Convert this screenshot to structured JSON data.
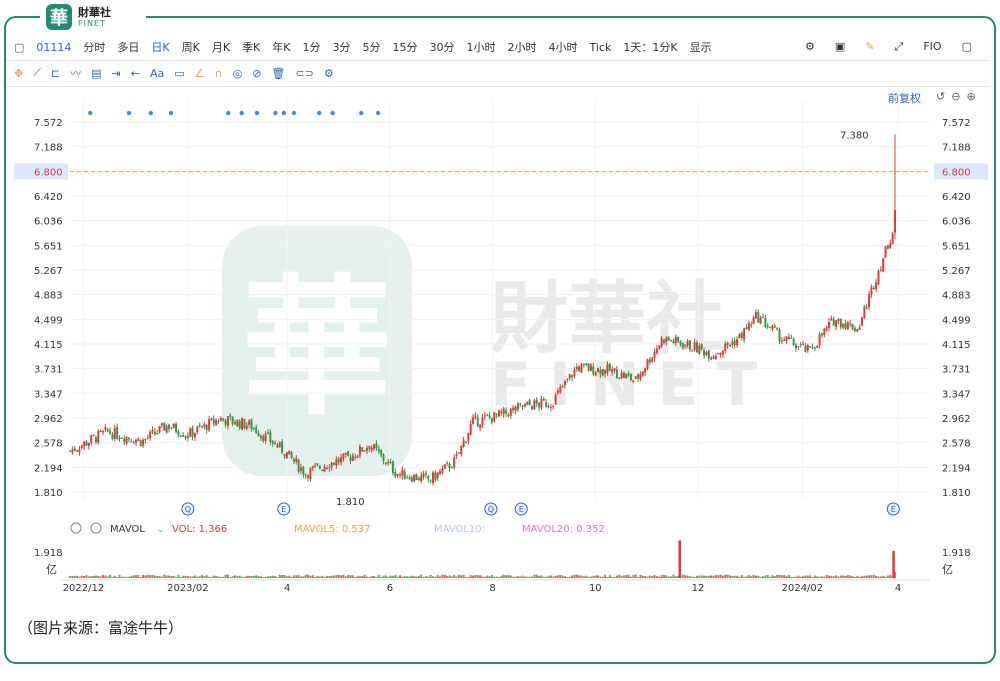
{
  "brand": {
    "seal_char": "華",
    "name": "財華社",
    "sub": "FINET"
  },
  "toolbar": {
    "code": "01114",
    "periods": [
      "分时",
      "多日",
      "日K",
      "周K",
      "月K",
      "季K",
      "年K",
      "1分",
      "3分",
      "5分",
      "15分",
      "30分",
      "1小时",
      "2小时",
      "4小时",
      "Tick",
      "1天：1分K"
    ],
    "selected": "日K",
    "display_label": "显示",
    "fio_label": "FIO"
  },
  "drawing_tools": {
    "text_label": "Aa"
  },
  "fuquan_label": "前复权",
  "watermark": {
    "char": "華",
    "cn": "財華社",
    "en": "FINET"
  },
  "volume_legend": {
    "indicator": "MAVOL",
    "vol": "VOL: 1.366",
    "ma5": "MAVOL5: 0.537",
    "ma10": "MAVOL10:",
    "ma20": "MAVOL20: 0.352"
  },
  "volume_axis": {
    "top": "1.918",
    "unit": "亿"
  },
  "event_markers": [
    {
      "label": "Q",
      "x": "2023-02-01"
    },
    {
      "label": "E",
      "x": "2023-03-30"
    },
    {
      "label": "Q",
      "x": "2023-07-31"
    },
    {
      "label": "E",
      "x": "2023-08-18"
    },
    {
      "label": "E",
      "x": "2024-03-26"
    }
  ],
  "caption": "（图片来源：富途牛牛）",
  "colors": {
    "up": "#e53935",
    "down": "#2e9c3f",
    "accent": "#1e8f74",
    "ref_line": "#f0a040",
    "ma5": "#f0a040",
    "ma10": "#b0c8f0",
    "ma20": "#e070e0"
  },
  "chart_data": {
    "type": "candlestick",
    "title": "",
    "x_tick_labels": [
      "2022/12",
      "2023/02",
      "4",
      "6",
      "8",
      "10",
      "12",
      "2024/02",
      "4"
    ],
    "y_tick_labels": [
      "7.572",
      "7.188",
      "6.800",
      "6.420",
      "6.036",
      "5.651",
      "5.267",
      "4.883",
      "4.499",
      "4.115",
      "3.731",
      "3.347",
      "2.962",
      "2.578",
      "2.194",
      "1.810"
    ],
    "ylim": [
      1.81,
      7.572
    ],
    "reference_line": {
      "value": "6.800"
    },
    "annotations": [
      {
        "text": "7.380",
        "value": 7.38
      },
      {
        "text": "1.810",
        "value": 1.81
      }
    ],
    "close_anchors": [
      {
        "date": "2022-11-23",
        "close": 2.45
      },
      {
        "date": "2022-12-15",
        "close": 2.75
      },
      {
        "date": "2023-01-05",
        "close": 2.6
      },
      {
        "date": "2023-01-20",
        "close": 2.85
      },
      {
        "date": "2023-02-01",
        "close": 2.7
      },
      {
        "date": "2023-02-20",
        "close": 2.95
      },
      {
        "date": "2023-03-10",
        "close": 2.85
      },
      {
        "date": "2023-03-30",
        "close": 2.45
      },
      {
        "date": "2023-04-12",
        "close": 2.1
      },
      {
        "date": "2023-04-25",
        "close": 2.25
      },
      {
        "date": "2023-05-08",
        "close": 2.35
      },
      {
        "date": "2023-05-20",
        "close": 2.55
      },
      {
        "date": "2023-06-05",
        "close": 2.1
      },
      {
        "date": "2023-06-25",
        "close": 2.0
      },
      {
        "date": "2023-07-10",
        "close": 2.3
      },
      {
        "date": "2023-07-20",
        "close": 2.9
      },
      {
        "date": "2023-08-05",
        "close": 3.0
      },
      {
        "date": "2023-08-20",
        "close": 3.15
      },
      {
        "date": "2023-09-05",
        "close": 3.2
      },
      {
        "date": "2023-09-20",
        "close": 3.75
      },
      {
        "date": "2023-10-10",
        "close": 3.7
      },
      {
        "date": "2023-10-25",
        "close": 3.55
      },
      {
        "date": "2023-11-10",
        "close": 4.2
      },
      {
        "date": "2023-11-25",
        "close": 4.1
      },
      {
        "date": "2023-12-10",
        "close": 3.95
      },
      {
        "date": "2023-12-25",
        "close": 4.2
      },
      {
        "date": "2024-01-05",
        "close": 4.55
      },
      {
        "date": "2024-01-20",
        "close": 4.2
      },
      {
        "date": "2024-02-05",
        "close": 4.0
      },
      {
        "date": "2024-02-20",
        "close": 4.5
      },
      {
        "date": "2024-03-05",
        "close": 4.35
      },
      {
        "date": "2024-03-15",
        "close": 5.1
      },
      {
        "date": "2024-03-22",
        "close": 5.6
      },
      {
        "date": "2024-03-26",
        "close": 5.9
      },
      {
        "date": "2024-03-27",
        "close": 6.2
      }
    ],
    "last_candle": {
      "date": "2024-03-27",
      "open": 5.85,
      "high": 7.38,
      "low": 5.75,
      "close": 6.2
    },
    "volume": {
      "max_label": "1.918",
      "unit": "亿",
      "spikes": [
        {
          "date": "2023-11-20",
          "value": 1.9
        },
        {
          "date": "2024-03-26",
          "value": 1.37
        }
      ]
    },
    "dot_markers_dates": [
      "2022-12-05",
      "2022-12-28",
      "2023-01-10",
      "2023-01-22",
      "2023-02-25",
      "2023-03-05",
      "2023-03-14",
      "2023-03-25",
      "2023-03-30",
      "2023-04-05",
      "2023-04-20",
      "2023-04-28",
      "2023-05-15",
      "2023-05-25"
    ]
  }
}
